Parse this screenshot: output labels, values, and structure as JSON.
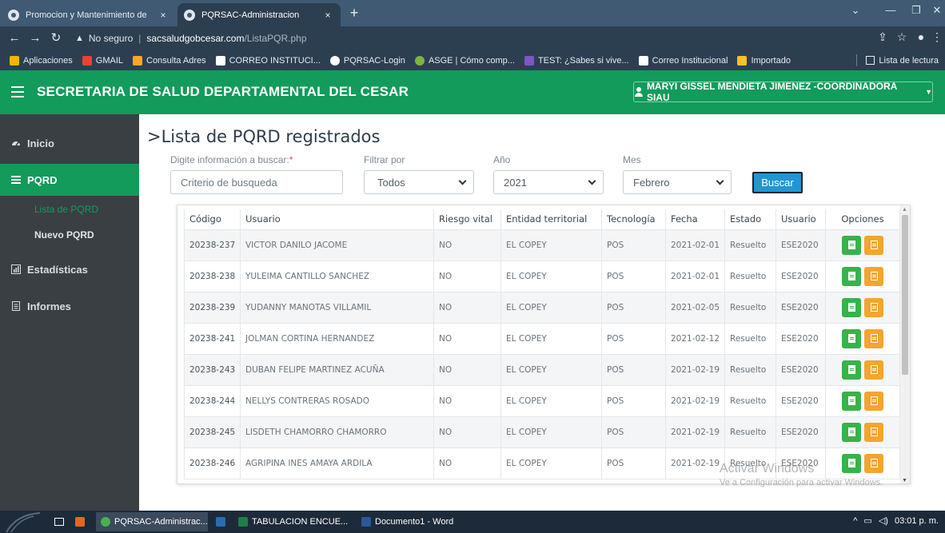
{
  "browser": {
    "tabs": [
      {
        "label": "Promocion y Mantenimiento de"
      },
      {
        "label": "PQRSAC-Administracion"
      }
    ],
    "tab_close": "×",
    "new_tab": "+",
    "window_controls": {
      "dropdown": "⌄",
      "minimize": "—",
      "restore": "❐",
      "close": "✕"
    },
    "address": {
      "security": "No seguro",
      "host": "sacsaludgobcesar.com",
      "path": "/ListaPQR.php"
    },
    "bookmarks": [
      {
        "label": "Aplicaciones",
        "color": "#f4b400"
      },
      {
        "label": "GMAIL",
        "color": "#ea4335"
      },
      {
        "label": "Consulta Adres",
        "color": "#f9a825"
      },
      {
        "label": "CORREO INSTITUCI...",
        "color": "#ffffff"
      },
      {
        "label": "PQRSAC-Login",
        "color": "#ffffff"
      },
      {
        "label": "ASGE | Cómo comp...",
        "color": "#7cb342"
      },
      {
        "label": "TEST: ¿Sabes si vive...",
        "color": "#7e57c2"
      },
      {
        "label": "Correo Institucional",
        "color": "#ffffff"
      },
      {
        "label": "Importado",
        "color": "#fbc02d"
      }
    ],
    "reading_list": "Lista de lectura"
  },
  "app": {
    "title": "SECRETARIA DE SALUD DEPARTAMENTAL DEL CESAR",
    "user": "MARYI GISSEL MENDIETA JIMENEZ -COORDINADORA SIAU",
    "accent": "#129b5b"
  },
  "sidebar": {
    "items": [
      {
        "label": "Inicio",
        "icon": "dashboard-icon"
      },
      {
        "label": "PQRD",
        "icon": "list-icon"
      },
      {
        "label": "Estadísticas",
        "icon": "chart-icon"
      },
      {
        "label": "Informes",
        "icon": "file-icon"
      }
    ],
    "sub": [
      {
        "label": "Lista de PQRD"
      },
      {
        "label": "Nuevo PQRD"
      }
    ]
  },
  "main": {
    "title": ">Lista de PQRD registrados",
    "search": {
      "label": "Digite información a buscar:",
      "required": "*",
      "placeholder": "Criterio de busqueda"
    },
    "filter": {
      "label": "Filtrar por",
      "value": "Todos"
    },
    "year": {
      "label": "Año",
      "value": "2021"
    },
    "month": {
      "label": "Mes",
      "value": "Febrero"
    },
    "search_button": "Buscar"
  },
  "table": {
    "headers": [
      "Código",
      "Usuario",
      "Riesgo vital",
      "Entidad territorial",
      "Tecnología",
      "Fecha",
      "Estado",
      "Usuario",
      "Opciones"
    ],
    "rows": [
      [
        "20238-237",
        "VICTOR DANILO JACOME",
        "NO",
        "EL COPEY",
        "POS",
        "2021-02-01",
        "Resuelto",
        "ESE2020"
      ],
      [
        "20238-238",
        "YULEIMA CANTILLO SANCHEZ",
        "NO",
        "EL COPEY",
        "POS",
        "2021-02-01",
        "Resuelto",
        "ESE2020"
      ],
      [
        "20238-239",
        "YUDANNY MANOTAS VILLAMIL",
        "NO",
        "EL COPEY",
        "POS",
        "2021-02-05",
        "Resuelto",
        "ESE2020"
      ],
      [
        "20238-241",
        "JOLMAN CORTINA HERNANDEZ",
        "NO",
        "EL COPEY",
        "POS",
        "2021-02-12",
        "Resuelto",
        "ESE2020"
      ],
      [
        "20238-243",
        "DUBAN FELIPE MARTINEZ ACUÑA",
        "NO",
        "EL COPEY",
        "POS",
        "2021-02-19",
        "Resuelto",
        "ESE2020"
      ],
      [
        "20238-244",
        "NELLYS CONTRERAS ROSADO",
        "NO",
        "EL COPEY",
        "POS",
        "2021-02-19",
        "Resuelto",
        "ESE2020"
      ],
      [
        "20238-245",
        "LISDETH CHAMORRO CHAMORRO",
        "NO",
        "EL COPEY",
        "POS",
        "2021-02-19",
        "Resuelto",
        "ESE2020"
      ],
      [
        "20238-246",
        "AGRIPINA INES AMAYA ARDILA",
        "NO",
        "EL COPEY",
        "POS",
        "2021-02-19",
        "Resuelto",
        "ESE2020"
      ]
    ]
  },
  "watermark": {
    "line1": "Activar Windows",
    "line2": "Ve a Configuración para activar Windows."
  },
  "taskbar": {
    "apps": [
      {
        "label": "PQRSAC-Administrac...",
        "color": "#4caf50"
      },
      {
        "label": "",
        "color": "#2b6cb0"
      },
      {
        "label": "TABULACION ENCUE...",
        "color": "#1e7e45"
      },
      {
        "label": "Documento1 - Word",
        "color": "#2b579a"
      }
    ],
    "tray": {
      "chevron": "^",
      "time": "03:01 p. m."
    }
  }
}
